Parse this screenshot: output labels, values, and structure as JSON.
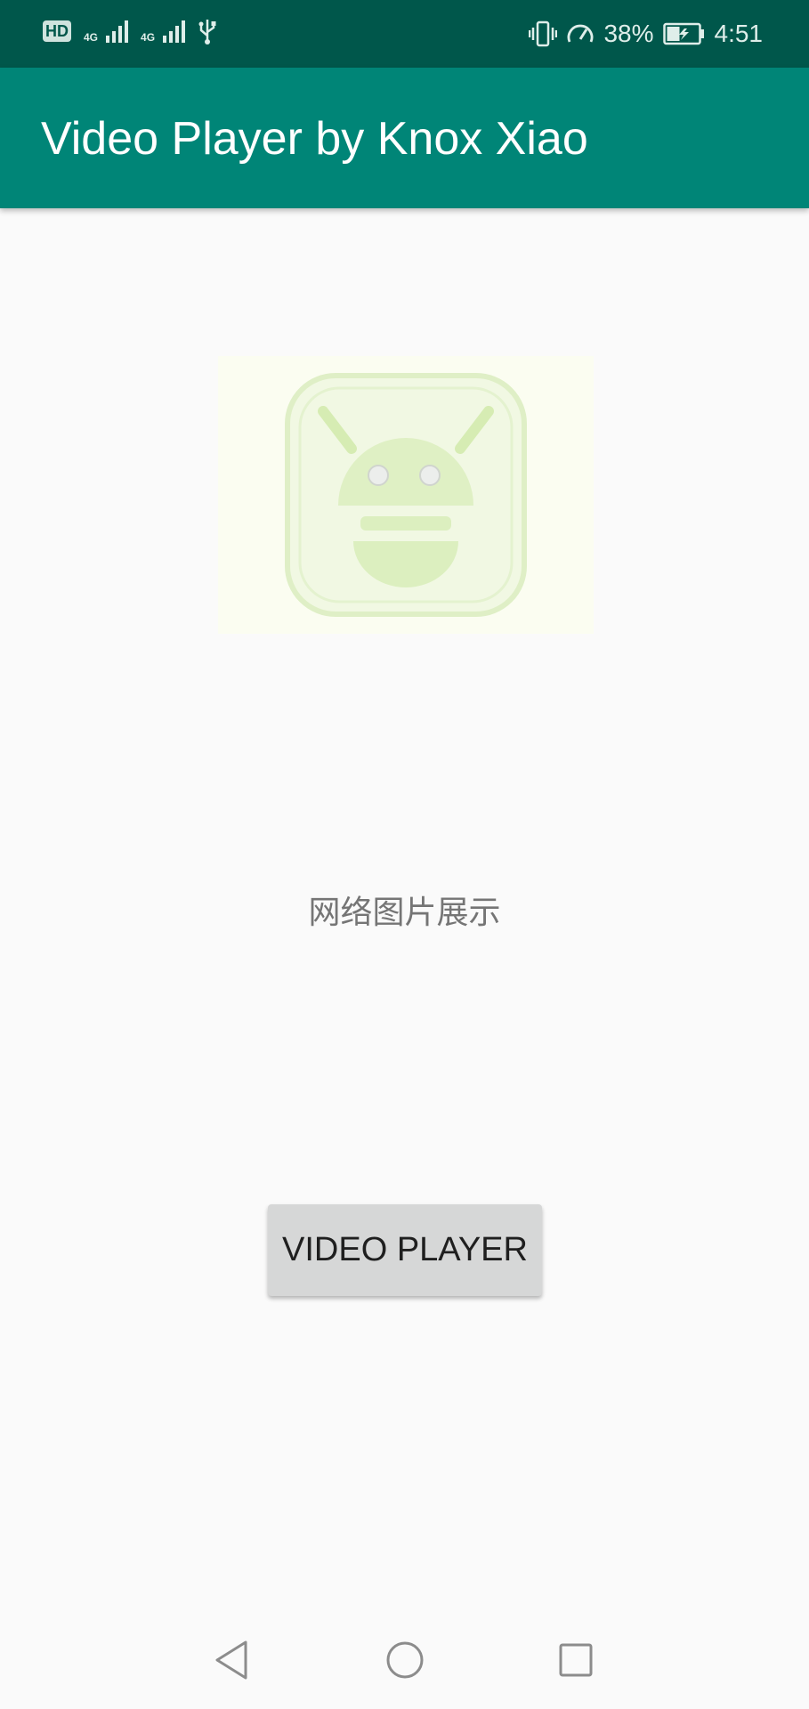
{
  "status_bar": {
    "left_icons": [
      "hd-icon",
      "signal-4g-icon",
      "signal-4g-icon",
      "usb-icon"
    ],
    "hd_label": "HD",
    "network_label": "4G",
    "right_icons": [
      "vibrate-icon",
      "speedometer-icon",
      "battery-charging-icon"
    ],
    "battery_percent": "38%",
    "time": "4:51"
  },
  "app_bar": {
    "title": "Video Player by Knox Xiao",
    "color": "#008577",
    "status_color": "#00574b"
  },
  "main": {
    "image_icon": "android-robot-icon",
    "image_caption": "网络图片展示",
    "video_button_label": "VIDEO PLAYER"
  },
  "nav_bar": {
    "items": [
      "back-icon",
      "home-icon",
      "recents-icon"
    ]
  }
}
